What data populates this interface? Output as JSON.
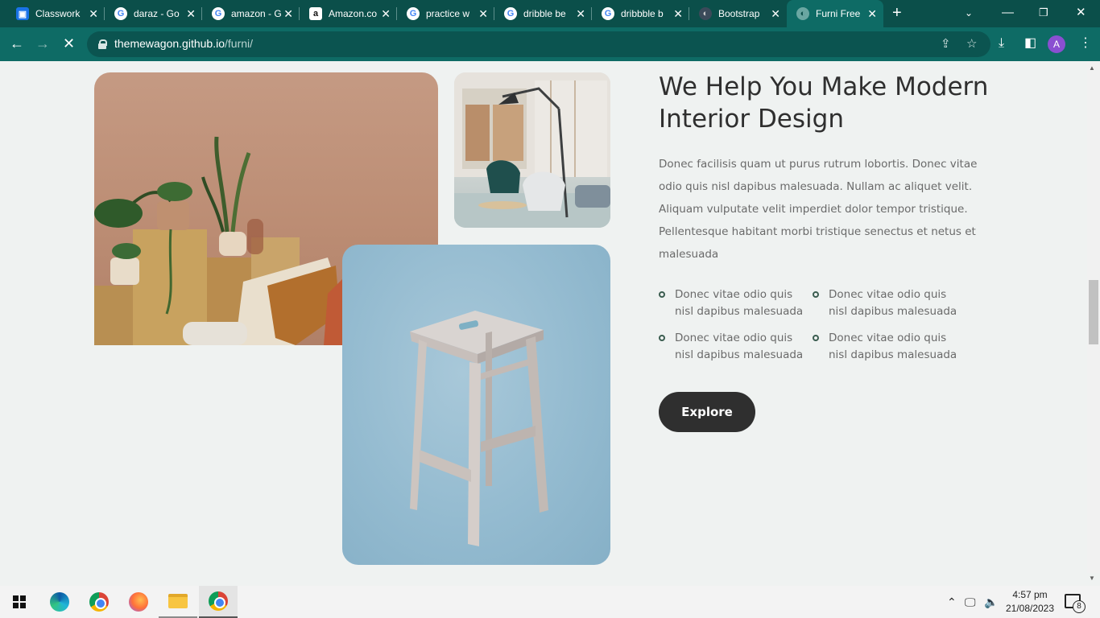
{
  "browser": {
    "tabs": [
      {
        "title": "Classwork",
        "icon": "classroom-icon"
      },
      {
        "title": "daraz - Go",
        "icon": "google-icon"
      },
      {
        "title": "amazon - G",
        "icon": "google-icon"
      },
      {
        "title": "Amazon.co",
        "icon": "amazon-icon"
      },
      {
        "title": "practice w",
        "icon": "google-icon"
      },
      {
        "title": "dribble be",
        "icon": "google-icon"
      },
      {
        "title": "dribbble b",
        "icon": "google-icon"
      },
      {
        "title": "Bootstrap",
        "icon": "bootstrap-icon"
      },
      {
        "title": "Furni Free",
        "icon": "furni-icon"
      }
    ],
    "active_tab_index": 8,
    "url_host": "themewagon.github.io",
    "url_path": "/furni/",
    "profile_initial": "A"
  },
  "section": {
    "heading": "We Help You Make Modern Interior Design",
    "paragraph": "Donec facilisis quam ut purus rutrum lobortis. Donec vitae odio quis nisl dapibus malesuada. Nullam ac aliquet velit. Aliquam vulputate velit imperdiet dolor tempor tristique. Pellentesque habitant morbi tristique senectus et netus et malesuada",
    "bullets": [
      "Donec vitae odio quis nisl dapibus malesuada",
      "Donec vitae odio quis nisl dapibus malesuada",
      "Donec vitae odio quis nisl dapibus malesuada",
      "Donec vitae odio quis nisl dapibus malesuada"
    ],
    "button_label": "Explore",
    "accent_color": "#3b5d50",
    "button_color": "#2f2f2f"
  },
  "taskbar": {
    "apps": [
      "windows-start-icon",
      "edge-icon",
      "chrome-icon",
      "firefox-icon",
      "file-explorer-icon",
      "chrome-profile-icon"
    ],
    "time": "4:57 pm",
    "date": "21/08/2023",
    "notification_count": "8"
  }
}
